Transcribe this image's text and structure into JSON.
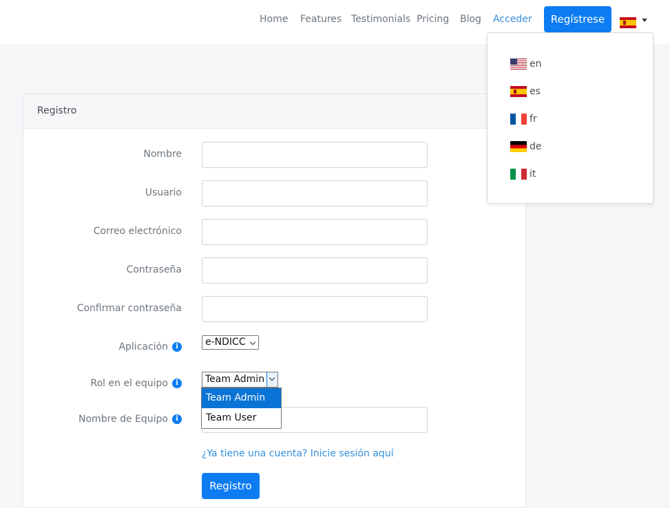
{
  "nav": {
    "links": [
      "Home",
      "Features",
      "Testimonials",
      "Pricing",
      "Blog"
    ],
    "login": "Acceder",
    "signup": "Regístrese",
    "current_lang_flag": "es-flag"
  },
  "lang_menu": {
    "items": [
      {
        "code": "en",
        "flag": "us-flag"
      },
      {
        "code": "es",
        "flag": "es-flag"
      },
      {
        "code": "fr",
        "flag": "fr-flag"
      },
      {
        "code": "de",
        "flag": "de-flag"
      },
      {
        "code": "it",
        "flag": "it-flag"
      }
    ]
  },
  "form": {
    "title": "Registro",
    "fields": {
      "name": {
        "label": "Nombre",
        "value": ""
      },
      "username": {
        "label": "Usuario",
        "value": ""
      },
      "email": {
        "label": "Correo electrónico",
        "value": ""
      },
      "password": {
        "label": "Contraseña",
        "value": ""
      },
      "confirm_password": {
        "label": "Confirmar contraseña",
        "value": ""
      },
      "application": {
        "label": "Aplicación",
        "value": "e-NDICC"
      },
      "team_role": {
        "label": "Rol en el equipo",
        "value": "Team Admin",
        "options": [
          "Team Admin",
          "Team User"
        ]
      },
      "team_name": {
        "label": "Nombre de Equipo",
        "value": ""
      }
    },
    "login_link": "¿Ya tiene una cuenta? Inicie sesión aquí",
    "submit": "Registro"
  },
  "colors": {
    "primary": "#0d7cf2",
    "link": "#3490dc",
    "selected_option": "#0a74d6"
  },
  "icons": {
    "info": "i"
  }
}
